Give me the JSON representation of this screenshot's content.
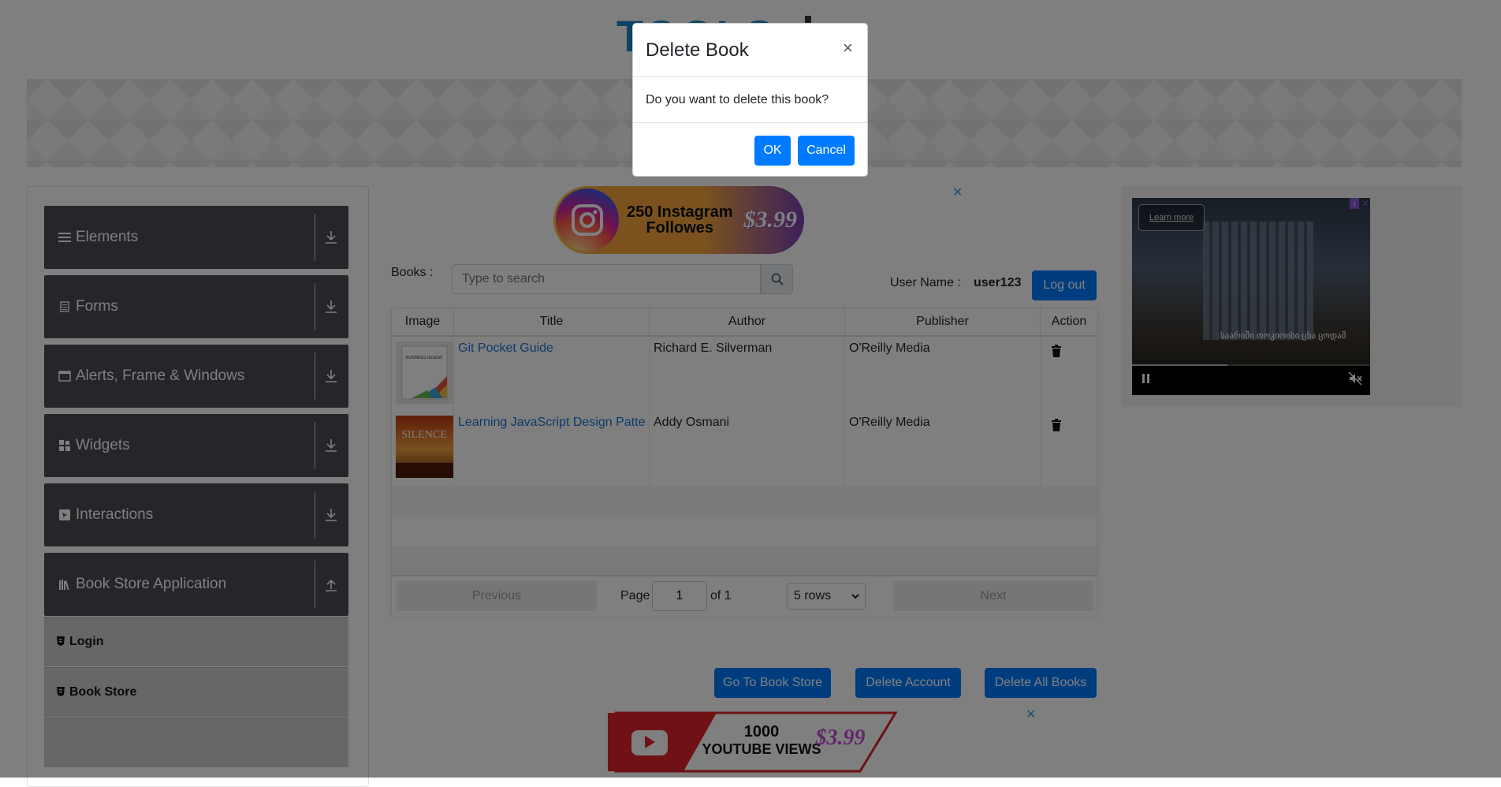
{
  "header": {
    "logo_text": "TOOLS"
  },
  "sidebar": {
    "groups": [
      {
        "label": "Elements",
        "icon": "hamburger-icon"
      },
      {
        "label": "Forms",
        "icon": "document-icon"
      },
      {
        "label": "Alerts, Frame & Windows",
        "icon": "window-icon"
      },
      {
        "label": "Widgets",
        "icon": "grid-icon"
      },
      {
        "label": "Interactions",
        "icon": "cursor-icon"
      },
      {
        "label": "Book Store Application",
        "icon": "library-icon"
      }
    ],
    "items": [
      {
        "label": "Login"
      },
      {
        "label": "Book Store"
      }
    ]
  },
  "ads": {
    "instagram_text_line1": "250 Instagram",
    "instagram_text_line2": "Followes",
    "instagram_price": "$3.99",
    "video_learn_more": "Learn more",
    "video_caption": "საარიში თოკიოისი ცხა ცოდამ",
    "youtube_count": "1000",
    "youtube_label": "YOUTUBE VIEWS",
    "youtube_price": "$3.99",
    "video_progress": 0.4,
    "close_glyph": "✕"
  },
  "profile": {
    "books_label": "Books :",
    "search_placeholder": "Type to search",
    "user_label": "User Name :",
    "user_value": "user123",
    "logout_label": "Log out"
  },
  "table": {
    "headers": [
      "Image",
      "Title",
      "Author",
      "Publisher",
      "Action"
    ],
    "rows": [
      {
        "title": "Git Pocket Guide",
        "author": "Richard E. Silverman",
        "publisher": "O'Reilly Media",
        "thumb_text": "BUSINESS DESIGN"
      },
      {
        "title": "Learning JavaScript Design Patterns",
        "author": "Addy Osmani",
        "publisher": "O'Reilly Media",
        "thumb_text": "SILENCE"
      }
    ]
  },
  "pager": {
    "previous": "Previous",
    "page_label": "Page",
    "page_value": "1",
    "of_label": "of 1",
    "rows_option": "5 rows",
    "next": "Next"
  },
  "actions": {
    "go_to_store": "Go To Book Store",
    "delete_account": "Delete Account",
    "delete_all": "Delete All Books"
  },
  "modal": {
    "title": "Delete Book",
    "close": "×",
    "body": "Do you want to delete this book?",
    "ok": "OK",
    "cancel": "Cancel"
  },
  "colors": {
    "primary": "#007bff",
    "sidebar_header": "#484c55",
    "link": "#1a75d2"
  }
}
